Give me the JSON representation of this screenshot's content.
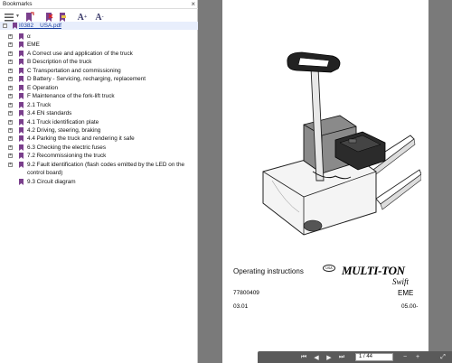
{
  "bookmarks_panel": {
    "title": "Bookmarks",
    "close_glyph": "×",
    "root_label": "I0382__USA.pdf",
    "items": [
      {
        "label": "α"
      },
      {
        "label": "EME"
      },
      {
        "label": "A Correct use and application of the truck"
      },
      {
        "label": "B Description of the truck"
      },
      {
        "label": "C Transportation and commissioning"
      },
      {
        "label": "D Battery - Servicing, recharging, replacement"
      },
      {
        "label": "E Operation"
      },
      {
        "label": "F Maintenance of the fork-lift truck"
      },
      {
        "label": "2.1 Truck"
      },
      {
        "label": "3.4 EN standards"
      },
      {
        "label": "4.1 Truck identification plate"
      },
      {
        "label": "4.2 Driving, steering, braking"
      },
      {
        "label": "4.4 Parking the truck and rendering it safe"
      },
      {
        "label": "6.3 Checking the electric fuses"
      },
      {
        "label": "7.2 Recommissioning the truck"
      },
      {
        "label": "9.2 Fault identification (flash codes emitted by the LED on the"
      },
      {
        "label": "control board)"
      },
      {
        "label": "9.3 Circuit diagram"
      }
    ]
  },
  "document": {
    "title": "Operating instructions",
    "badge": "USA",
    "brand": "MULTI-TON",
    "brand_sub": "Swift",
    "part_number": "77800409",
    "model": "EME",
    "date": "03.01",
    "version": "05.00-"
  },
  "nav": {
    "page_info": "1 / 44"
  },
  "colors": {
    "viewer_bg": "#7a7a7a",
    "bookmark_icon": "#7a3f8c",
    "link": "#1a3fa0"
  }
}
